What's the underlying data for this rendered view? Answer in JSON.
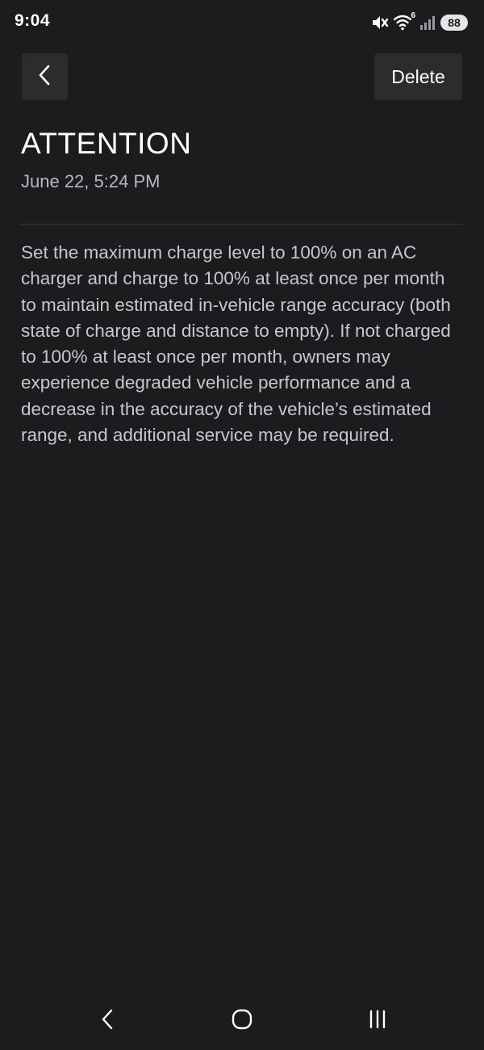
{
  "status_bar": {
    "time": "9:04",
    "wifi_badge": "6",
    "battery": "88",
    "icons": [
      "mute-icon",
      "wifi-icon",
      "signal-icon",
      "battery-icon"
    ]
  },
  "header": {
    "back_icon": "chevron-left-icon",
    "delete_label": "Delete"
  },
  "message": {
    "title": "ATTENTION",
    "date": "June 22, 5:24 PM",
    "body": "Set the maximum charge level to 100% on an AC charger and charge to 100% at least once per month to maintain estimated in-vehicle range accuracy (both state of charge and distance to empty). If not charged to 100% at least once per month, owners may experience degraded vehicle performance and a decrease in the accuracy of the vehicle’s estimated range, and additional service may be required."
  },
  "nav_bar": {
    "icons": [
      "nav-back-icon",
      "nav-home-icon",
      "nav-recents-icon"
    ]
  },
  "colors": {
    "background": "#1c1c1e",
    "button_bg": "#2c2c2e",
    "title": "#ffffff",
    "body_text": "#c7c7cc"
  }
}
